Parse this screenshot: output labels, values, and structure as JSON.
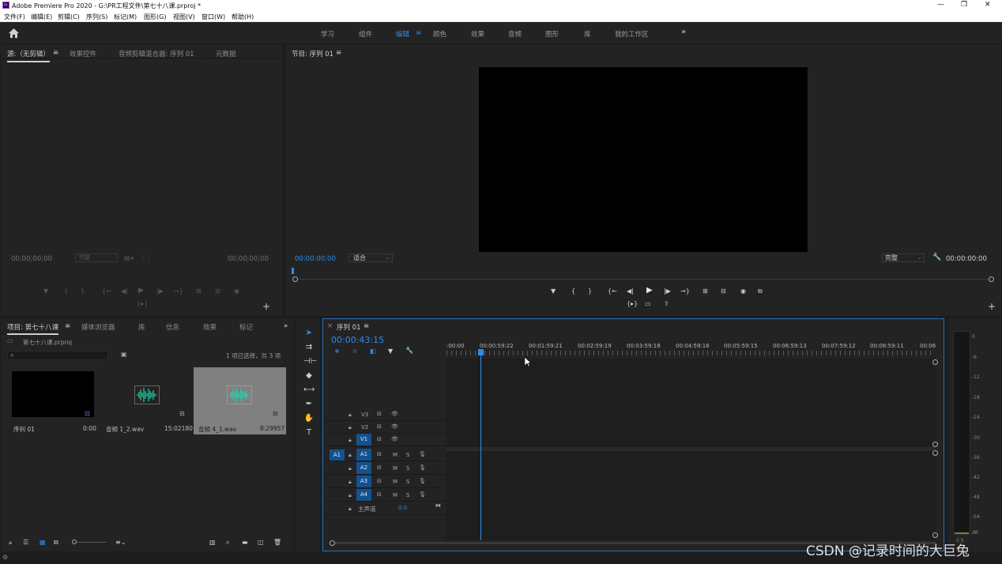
{
  "window": {
    "title": "Adobe Premiere Pro 2020 - G:\\PR工程文件\\第七十八课.prproj *",
    "app_logo": "Pr",
    "controls": [
      "—",
      "❐",
      "✕"
    ]
  },
  "menu": [
    "文件(F)",
    "编辑(E)",
    "剪辑(C)",
    "序列(S)",
    "标记(M)",
    "图形(G)",
    "视图(V)",
    "窗口(W)",
    "帮助(H)"
  ],
  "workspaces": {
    "items": [
      "学习",
      "组件",
      "编辑",
      "颜色",
      "效果",
      "音频",
      "图形",
      "库",
      "我的工作区"
    ],
    "active": "编辑",
    "more": "»",
    "menu_glyph": "≡"
  },
  "source_panel": {
    "tabs": [
      "源:（无剪辑）",
      "效果控件",
      "音频剪辑混合器: 序列 01",
      "元数据"
    ],
    "tab_menu": "≡",
    "tc_left": "00;00;00;00",
    "tc_right": "00;00;00;00",
    "fit": "完整",
    "controls": [
      "▼",
      "{",
      "}",
      "{←",
      "◀|",
      "▶",
      "|▶",
      "→}",
      "⊞",
      "⊟",
      "◉"
    ],
    "extra": "{▸}",
    "add": "+"
  },
  "program_panel": {
    "title": "节目: 序列 01",
    "title_menu": "≡",
    "tc_left": "00:00:00:00",
    "fit_left": "适合",
    "fit_right": "完整",
    "tc_right": "00:00:00:00",
    "controls": [
      "▼",
      "{",
      "}",
      "{←",
      "◀|",
      "▶",
      "|▶",
      "→}",
      "⊞",
      "⊟",
      "◉",
      "⧉"
    ],
    "controls_row2": [
      "{▸}",
      "▭",
      "⇪"
    ],
    "add": "+"
  },
  "project_panel": {
    "tabs": [
      "项目: 第七十八课",
      "媒体浏览器",
      "库",
      "信息",
      "效果",
      "标记"
    ],
    "tab_menu": "≡",
    "more": "»",
    "project_file": "第七十八课.prproj",
    "search_placeholder": "",
    "selection_text": "1 项已选择，共 3 项",
    "items": [
      {
        "name": "序列 01",
        "duration": "0:00",
        "kind": "sequence"
      },
      {
        "name": "音频 1_2.wav",
        "duration": "15:02180",
        "kind": "audio"
      },
      {
        "name": "音频 4_1.wav",
        "duration": "8:29957",
        "kind": "audio",
        "selected": true
      }
    ]
  },
  "timeline": {
    "title": "序列 01",
    "title_menu": "≡",
    "close": "×",
    "timecode": "00:00:43:15",
    "ruler": [
      ":00:00",
      "00:00:59:22",
      "00:01:59:21",
      "00:02:59:19",
      "00:03:59:18",
      "00:04:59:16",
      "00:05:59:15",
      "00:06:59:13",
      "00:07:59:12",
      "00:08:59:11",
      "00:06"
    ],
    "video_tracks": [
      "V3",
      "V2",
      "V1"
    ],
    "audio_tracks": [
      "A1",
      "A2",
      "A3",
      "A4"
    ],
    "source_patch": "A1",
    "mute": "M",
    "solo": "S",
    "master_label": "主声道",
    "master_value": "0.0"
  },
  "meter": {
    "labels": [
      "0",
      "-6",
      "-12",
      "-18",
      "-24",
      "-30",
      "-36",
      "-42",
      "-48",
      "-54",
      "dB"
    ],
    "footer": "S  S"
  },
  "watermark": "CSDN @记录时间的大巨兔",
  "colors": {
    "accent": "#2d8ceb",
    "panel": "#232323",
    "bg": "#1d1d1d",
    "audio_clip": "#1fbf9b",
    "track_target": "#14528f"
  }
}
